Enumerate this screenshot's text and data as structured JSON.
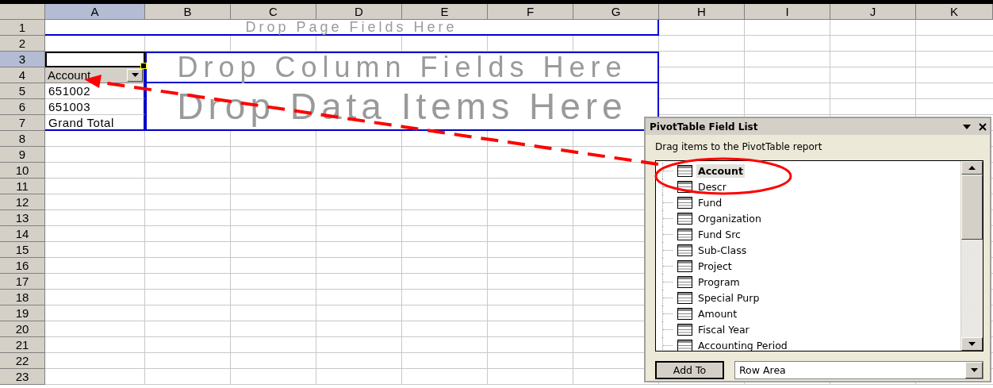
{
  "sheet": {
    "columns": [
      {
        "label": "A",
        "selected": true
      },
      {
        "label": "B",
        "selected": false
      },
      {
        "label": "C",
        "selected": false
      },
      {
        "label": "D",
        "selected": false
      },
      {
        "label": "E",
        "selected": false
      },
      {
        "label": "F",
        "selected": false
      },
      {
        "label": "G",
        "selected": false
      },
      {
        "label": "H",
        "selected": false
      },
      {
        "label": "I",
        "selected": false
      },
      {
        "label": "J",
        "selected": false
      },
      {
        "label": "K",
        "selected": false
      }
    ],
    "rows": [
      {
        "label": "1",
        "selected": false
      },
      {
        "label": "2",
        "selected": false
      },
      {
        "label": "3",
        "selected": true
      },
      {
        "label": "4",
        "selected": false
      },
      {
        "label": "5",
        "selected": false
      },
      {
        "label": "6",
        "selected": false
      },
      {
        "label": "7",
        "selected": false
      },
      {
        "label": "8",
        "selected": false
      },
      {
        "label": "9",
        "selected": false
      },
      {
        "label": "10",
        "selected": false
      },
      {
        "label": "11",
        "selected": false
      },
      {
        "label": "12",
        "selected": false
      },
      {
        "label": "13",
        "selected": false
      },
      {
        "label": "14",
        "selected": false
      },
      {
        "label": "15",
        "selected": false
      },
      {
        "label": "16",
        "selected": false
      },
      {
        "label": "17",
        "selected": false
      },
      {
        "label": "18",
        "selected": false
      },
      {
        "label": "19",
        "selected": false
      },
      {
        "label": "20",
        "selected": false
      },
      {
        "label": "21",
        "selected": false
      },
      {
        "label": "22",
        "selected": false
      },
      {
        "label": "23",
        "selected": false
      }
    ]
  },
  "pivot": {
    "page_zone": "Drop Page Fields Here",
    "column_zone": "Drop Column Fields Here",
    "data_zone": "Drop Data Items Here",
    "row_field": "Account",
    "row_items": [
      "651002",
      "651003",
      "Grand Total"
    ]
  },
  "field_list": {
    "title": "PivotTable Field List",
    "instruction": "Drag items to the PivotTable report",
    "fields": [
      {
        "label": "Account",
        "selected": true
      },
      {
        "label": "Descr",
        "selected": false
      },
      {
        "label": "Fund",
        "selected": false
      },
      {
        "label": "Organization",
        "selected": false
      },
      {
        "label": "Fund Src",
        "selected": false
      },
      {
        "label": "Sub-Class",
        "selected": false
      },
      {
        "label": "Project",
        "selected": false
      },
      {
        "label": "Program",
        "selected": false
      },
      {
        "label": "Special Purp",
        "selected": false
      },
      {
        "label": "Amount",
        "selected": false
      },
      {
        "label": "Fiscal Year",
        "selected": false
      },
      {
        "label": "Accounting Period",
        "selected": false
      }
    ],
    "add_button": "Add To",
    "area_dropdown": "Row Area"
  }
}
